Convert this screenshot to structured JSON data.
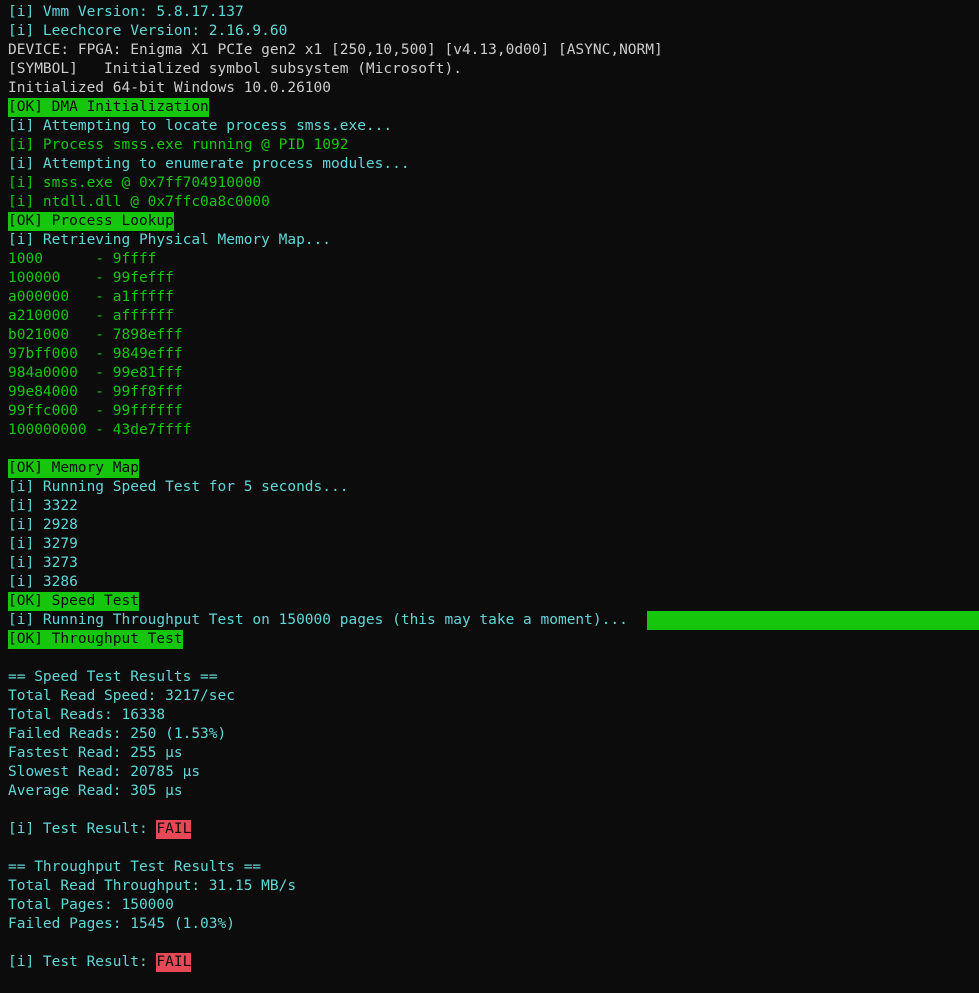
{
  "colors": {
    "background": "#0c0c0c",
    "cyan": "#61d6d6",
    "white": "#cccccc",
    "green": "#16c60c",
    "ok_bg": "#16c60c",
    "ok_fg": "#0c0c0c",
    "fail_bg": "#e74856",
    "fail_fg": "#0c0c0c"
  },
  "lines": [
    {
      "type": "text",
      "color": "cyan",
      "text": "[i] Vmm Version: 5.8.17.137"
    },
    {
      "type": "text",
      "color": "cyan",
      "text": "[i] Leechcore Version: 2.16.9.60"
    },
    {
      "type": "text",
      "color": "white",
      "text": "DEVICE: FPGA: Enigma X1 PCIe gen2 x1 [250,10,500] [v4.13,0d00] [ASYNC,NORM]"
    },
    {
      "type": "text",
      "color": "white",
      "text": "[SYMBOL]   Initialized symbol subsystem (Microsoft)."
    },
    {
      "type": "text",
      "color": "white",
      "text": "Initialized 64-bit Windows 10.0.26100"
    },
    {
      "type": "ok",
      "text": "[OK] DMA Initialization"
    },
    {
      "type": "text",
      "color": "cyan",
      "text": "[i] Attempting to locate process smss.exe..."
    },
    {
      "type": "text",
      "color": "green",
      "text": "[i] Process smss.exe running @ PID 1092"
    },
    {
      "type": "text",
      "color": "cyan",
      "text": "[i] Attempting to enumerate process modules..."
    },
    {
      "type": "text",
      "color": "green",
      "text": "[i] smss.exe @ 0x7ff704910000"
    },
    {
      "type": "text",
      "color": "green",
      "text": "[i] ntdll.dll @ 0x7ffc0a8c0000"
    },
    {
      "type": "ok",
      "text": "[OK] Process Lookup"
    },
    {
      "type": "text",
      "color": "cyan",
      "text": "[i] Retrieving Physical Memory Map..."
    },
    {
      "type": "text",
      "color": "green",
      "text": "1000      - 9ffff"
    },
    {
      "type": "text",
      "color": "green",
      "text": "100000    - 99fefff"
    },
    {
      "type": "text",
      "color": "green",
      "text": "a000000   - a1fffff"
    },
    {
      "type": "text",
      "color": "green",
      "text": "a210000   - affffff"
    },
    {
      "type": "text",
      "color": "green",
      "text": "b021000   - 7898efff"
    },
    {
      "type": "text",
      "color": "green",
      "text": "97bff000  - 9849efff"
    },
    {
      "type": "text",
      "color": "green",
      "text": "984a0000  - 99e81fff"
    },
    {
      "type": "text",
      "color": "green",
      "text": "99e84000  - 99ff8fff"
    },
    {
      "type": "text",
      "color": "green",
      "text": "99ffc000  - 99ffffff"
    },
    {
      "type": "text",
      "color": "green",
      "text": "100000000 - 43de7ffff"
    },
    {
      "type": "blank"
    },
    {
      "type": "ok",
      "text": "[OK] Memory Map"
    },
    {
      "type": "text",
      "color": "cyan",
      "text": "[i] Running Speed Test for 5 seconds..."
    },
    {
      "type": "text",
      "color": "cyan",
      "text": "[i] 3322"
    },
    {
      "type": "text",
      "color": "cyan",
      "text": "[i] 2928"
    },
    {
      "type": "text",
      "color": "cyan",
      "text": "[i] 3279"
    },
    {
      "type": "text",
      "color": "cyan",
      "text": "[i] 3273"
    },
    {
      "type": "text",
      "color": "cyan",
      "text": "[i] 3286"
    },
    {
      "type": "ok",
      "text": "[OK] Speed Test"
    },
    {
      "type": "progress",
      "color": "cyan",
      "text": "[i] Running Throughput Test on 150000 pages (this may take a moment)...",
      "progress": 1.0
    },
    {
      "type": "ok",
      "text": "[OK] Throughput Test"
    },
    {
      "type": "blank"
    },
    {
      "type": "text",
      "color": "cyan",
      "text": "== Speed Test Results =="
    },
    {
      "type": "text",
      "color": "cyan",
      "text": "Total Read Speed: 3217/sec"
    },
    {
      "type": "text",
      "color": "cyan",
      "text": "Total Reads: 16338"
    },
    {
      "type": "text",
      "color": "cyan",
      "text": "Failed Reads: 250 (1.53%)"
    },
    {
      "type": "text",
      "color": "cyan",
      "text": "Fastest Read: 255 µs"
    },
    {
      "type": "text",
      "color": "cyan",
      "text": "Slowest Read: 20785 µs"
    },
    {
      "type": "text",
      "color": "cyan",
      "text": "Average Read: 305 µs"
    },
    {
      "type": "blank"
    },
    {
      "type": "result",
      "color": "cyan",
      "text": "[i] Test Result: ",
      "result": "FAIL"
    },
    {
      "type": "blank"
    },
    {
      "type": "text",
      "color": "cyan",
      "text": "== Throughput Test Results =="
    },
    {
      "type": "text",
      "color": "cyan",
      "text": "Total Read Throughput: 31.15 MB/s"
    },
    {
      "type": "text",
      "color": "cyan",
      "text": "Total Pages: 150000"
    },
    {
      "type": "text",
      "color": "cyan",
      "text": "Failed Pages: 1545 (1.03%)"
    },
    {
      "type": "blank"
    },
    {
      "type": "result",
      "color": "cyan",
      "text": "[i] Test Result: ",
      "result": "FAIL"
    }
  ]
}
